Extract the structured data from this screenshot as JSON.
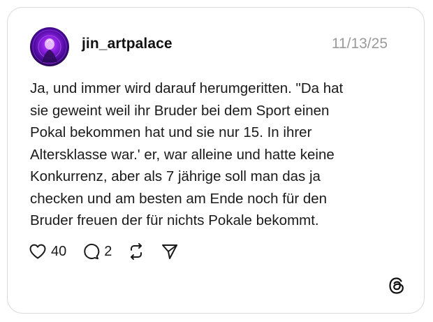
{
  "post": {
    "username": "jin_artpalace",
    "timestamp": "11/13/25",
    "body_lines": [
      "Ja, und immer wird darauf herumgeritten. \"Da hat",
      "sie geweint weil ihr Bruder bei dem Sport einen",
      "Pokal bekommen hat und sie nur 15. In ihrer",
      "Altersklasse war.' er, war alleine und hatte keine",
      "Konkurrenz, aber als 7 jährige soll man das ja",
      "checken und am besten am Ende noch für den",
      "Bruder freuen der für nichts Pokale bekommt."
    ],
    "likes": "40",
    "replies": "2"
  },
  "icons": {
    "like": "heart-icon",
    "reply": "comment-icon",
    "repost": "repost-icon",
    "share": "send-icon",
    "brand": "threads-logo-icon"
  },
  "colors": {
    "text": "#111111",
    "muted": "#9a9a9a",
    "border": "#d9d9d9",
    "avatar_accent": "#8a1fe0"
  }
}
